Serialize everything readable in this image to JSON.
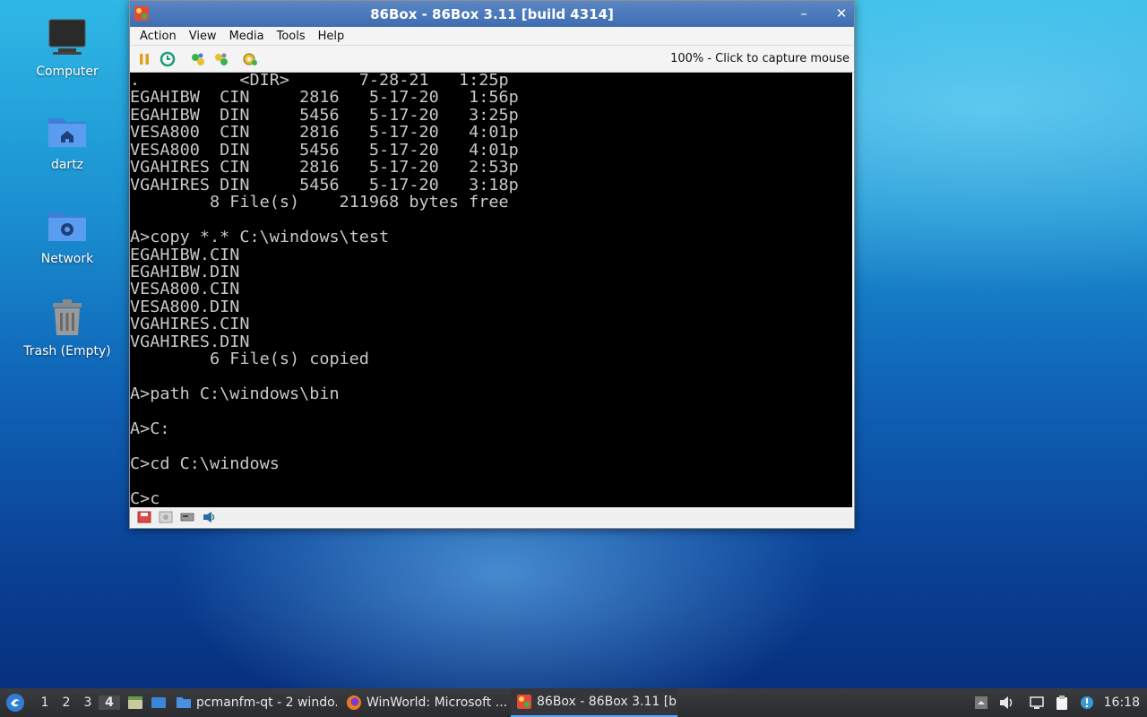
{
  "desktop": {
    "icons": [
      {
        "label": "Computer"
      },
      {
        "label": "dartz"
      },
      {
        "label": "Network"
      },
      {
        "label": "Trash (Empty)"
      }
    ]
  },
  "window": {
    "title": "86Box - 86Box 3.11 [build 4314]",
    "minimize": "–",
    "close": "✕",
    "menu": [
      "Action",
      "View",
      "Media",
      "Tools",
      "Help"
    ],
    "capture_status": "100% - Click to capture mouse",
    "toolbar_icons": [
      "pause-icon",
      "reset-icon",
      "ctrl-alt-del-icon",
      "ctrl-alt-esc-icon",
      "settings-icon"
    ],
    "status_icons": [
      "floppy-icon",
      "cdrom-icon",
      "hdd-icon",
      "sound-icon"
    ]
  },
  "terminal": {
    "lines": [
      ".          <DIR>       7-28-21   1:25p",
      "EGAHIBW  CIN     2816   5-17-20   1:56p",
      "EGAHIBW  DIN     5456   5-17-20   3:25p",
      "VESA800  CIN     2816   5-17-20   4:01p",
      "VESA800  DIN     5456   5-17-20   4:01p",
      "VGAHIRES CIN     2816   5-17-20   2:53p",
      "VGAHIRES DIN     5456   5-17-20   3:18p",
      "        8 File(s)    211968 bytes free",
      "",
      "A>copy *.* C:\\windows\\test",
      "EGAHIBW.CIN",
      "EGAHIBW.DIN",
      "VESA800.CIN",
      "VESA800.DIN",
      "VGAHIRES.CIN",
      "VGAHIRES.DIN",
      "        6 File(s) copied",
      "",
      "A>path C:\\windows\\bin",
      "",
      "A>C:",
      "",
      "C>cd C:\\windows",
      "",
      "C>c"
    ]
  },
  "taskbar": {
    "desktops": [
      "1",
      "2",
      "3",
      "4"
    ],
    "active_desktop": "4",
    "tasks": [
      {
        "label": "pcmanfm-qt - 2 windo..."
      },
      {
        "label": "WinWorld: Microsoft ..."
      },
      {
        "label": "86Box - 86Box 3.11 [b..."
      }
    ],
    "clock": "16:18"
  }
}
